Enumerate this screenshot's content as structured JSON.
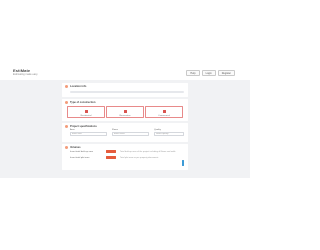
{
  "brand": {
    "name": "EstiMate",
    "tagline": "Estimating made easy"
  },
  "topnav": {
    "items": [
      "Help",
      "Login",
      "Register"
    ]
  },
  "sections": {
    "location": {
      "title": "Location info"
    },
    "type": {
      "title": "Type of construction",
      "options": [
        "Residential",
        "Renovation",
        "Commercial"
      ]
    },
    "project": {
      "title": "Project specifications",
      "fields": [
        {
          "label": "Area",
          "value": "Enter area"
        },
        {
          "label": "Floors",
          "value": "Enter floors"
        },
        {
          "label": "Quality",
          "value": "Select quality"
        }
      ]
    },
    "volume": {
      "title": "Volumes",
      "rows": [
        {
          "label": "Insert total built-up area",
          "hint": "Total built-up area of the project including all floors and walls"
        },
        {
          "label": "Insert total plot area",
          "hint": "Total plot area as per property documents"
        }
      ]
    }
  },
  "colors": {
    "accent": "#e55b3c",
    "info": "#3c9ad6",
    "background": "#f1f2f4"
  }
}
